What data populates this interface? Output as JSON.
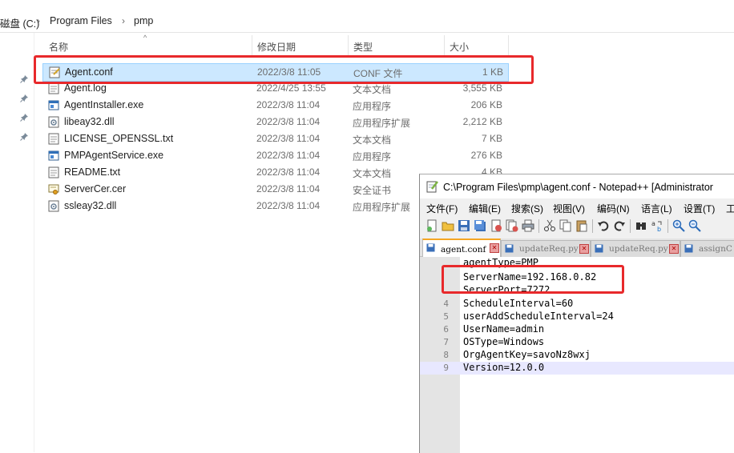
{
  "explorer": {
    "breadcrumb": [
      "磁盘 (C:)",
      "Program Files",
      "pmp"
    ],
    "columns": {
      "name": "名称",
      "date": "修改日期",
      "type": "类型",
      "size": "大小"
    },
    "files": [
      {
        "name": "Agent.conf",
        "date": "2022/3/8 11:05",
        "type": "CONF 文件",
        "size": "1 KB",
        "icon": "config-file-icon",
        "selected": true
      },
      {
        "name": "Agent.log",
        "date": "2022/4/25 13:55",
        "type": "文本文档",
        "size": "3,555 KB",
        "icon": "text-file-icon"
      },
      {
        "name": "AgentInstaller.exe",
        "date": "2022/3/8 11:04",
        "type": "应用程序",
        "size": "206 KB",
        "icon": "exe-icon"
      },
      {
        "name": "libeay32.dll",
        "date": "2022/3/8 11:04",
        "type": "应用程序扩展",
        "size": "2,212 KB",
        "icon": "dll-icon"
      },
      {
        "name": "LICENSE_OPENSSL.txt",
        "date": "2022/3/8 11:04",
        "type": "文本文档",
        "size": "7 KB",
        "icon": "text-file-icon"
      },
      {
        "name": "PMPAgentService.exe",
        "date": "2022/3/8 11:04",
        "type": "应用程序",
        "size": "276 KB",
        "icon": "exe-icon"
      },
      {
        "name": "README.txt",
        "date": "2022/3/8 11:04",
        "type": "文本文档",
        "size": "4 KB",
        "icon": "text-file-icon"
      },
      {
        "name": "ServerCer.cer",
        "date": "2022/3/8 11:04",
        "type": "安全证书",
        "size": "",
        "icon": "certificate-icon"
      },
      {
        "name": "ssleay32.dll",
        "date": "2022/3/8 11:04",
        "type": "应用程序扩展",
        "size": "",
        "icon": "dll-icon"
      }
    ]
  },
  "notepad": {
    "title": "C:\\Program Files\\pmp\\agent.conf - Notepad++ [Administrator",
    "menu": [
      "文件(F)",
      "编辑(E)",
      "搜索(S)",
      "视图(V)",
      "编码(N)",
      "语言(L)",
      "设置(T)",
      "工"
    ],
    "tabs": [
      {
        "label": "agent.conf",
        "active": true
      },
      {
        "label": "updateReq.py",
        "active": false
      },
      {
        "label": "updateReq.py",
        "active": false
      },
      {
        "label": "assignC",
        "active": false
      }
    ],
    "lines": [
      {
        "num": "",
        "text": "agentType=PMP"
      },
      {
        "num": "",
        "text": "ServerName=192.168.0.82"
      },
      {
        "num": "",
        "text": "ServerPort=7272"
      },
      {
        "num": "4",
        "text": "ScheduleInterval=60"
      },
      {
        "num": "5",
        "text": "userAddScheduleInterval=24"
      },
      {
        "num": "6",
        "text": "UserName=admin"
      },
      {
        "num": "7",
        "text": "OSType=Windows"
      },
      {
        "num": "8",
        "text": "OrgAgentKey=savoNz8wxj"
      },
      {
        "num": "9",
        "text": "Version=12.0.0"
      }
    ]
  },
  "colors": {
    "highlight_red": "#e8292b",
    "selection_blue": "#cce8ff",
    "current_line": "#e8e8ff"
  }
}
